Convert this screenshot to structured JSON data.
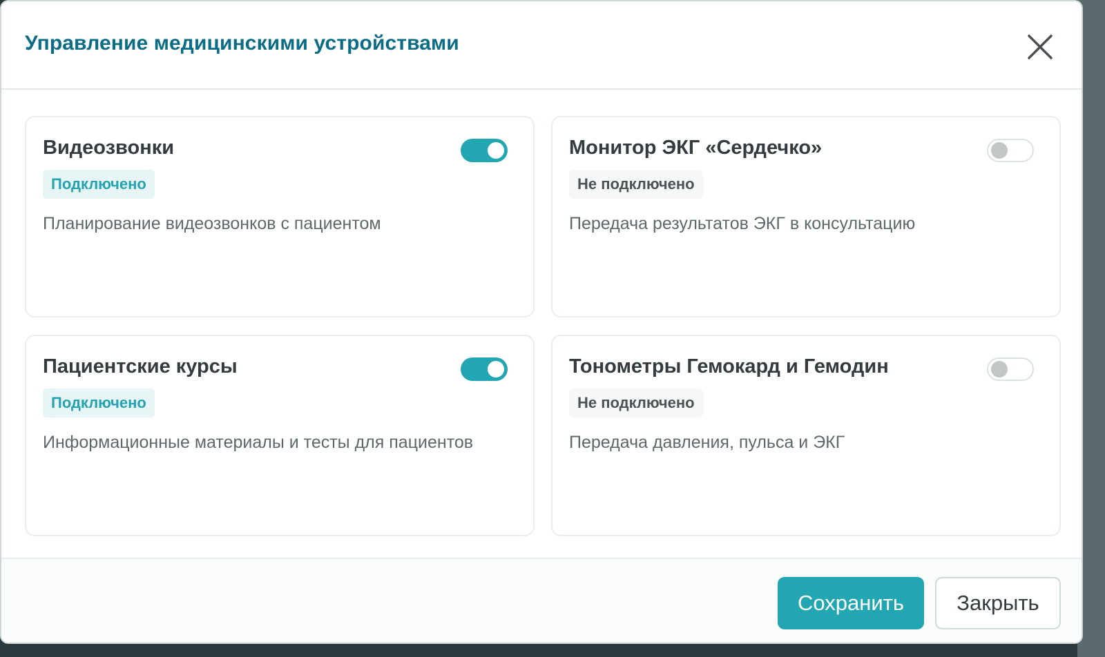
{
  "modal": {
    "title": "Управление медицинскими устройствами"
  },
  "devices": [
    {
      "title": "Видеозвонки",
      "status": "Подключено",
      "enabled": true,
      "description": "Планирование видеозвонков с пациентом"
    },
    {
      "title": "Монитор ЭКГ «Сердечко»",
      "status": "Не подключено",
      "enabled": false,
      "description": "Передача результатов ЭКГ в консультацию"
    },
    {
      "title": "Пациентские курсы",
      "status": "Подключено",
      "enabled": true,
      "description": "Информационные материалы и тесты для пациентов"
    },
    {
      "title": "Тонометры Гемокард и Гемодин",
      "status": "Не подключено",
      "enabled": false,
      "description": "Передача давления, пульса и ЭКГ"
    }
  ],
  "footer": {
    "save_label": "Сохранить",
    "close_label": "Закрыть"
  },
  "colors": {
    "accent": "#22a6b1",
    "title": "#0b6c86"
  },
  "icons": {
    "close": "close-icon"
  }
}
